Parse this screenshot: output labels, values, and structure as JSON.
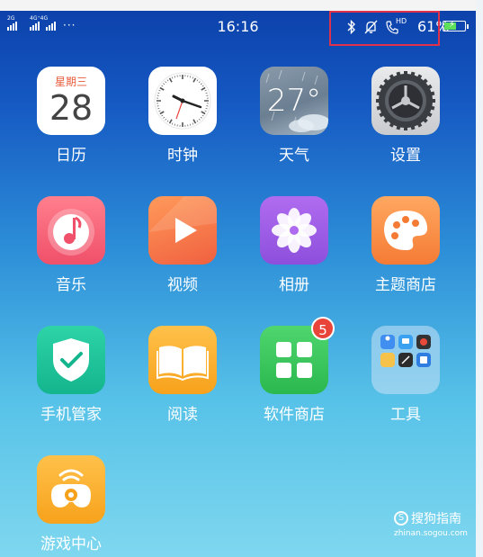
{
  "status_bar": {
    "network_tag_1": "2G",
    "network_tag_2": "4G⁺4G",
    "more": "···",
    "time": "16:16",
    "hd": "HD",
    "battery": "61%"
  },
  "apps": [
    {
      "id": "calendar",
      "label": "日历",
      "weekday": "星期三",
      "day": "28",
      "icon": "calendar-icon"
    },
    {
      "id": "clock",
      "label": "时钟",
      "icon": "clock-icon"
    },
    {
      "id": "weather",
      "label": "天气",
      "temp": "27°",
      "icon": "weather-icon"
    },
    {
      "id": "settings",
      "label": "设置",
      "icon": "gear-icon"
    },
    {
      "id": "music",
      "label": "音乐",
      "icon": "music-note-icon"
    },
    {
      "id": "video",
      "label": "视频",
      "icon": "play-icon"
    },
    {
      "id": "photos",
      "label": "相册",
      "icon": "flower-icon"
    },
    {
      "id": "theme",
      "label": "主题商店",
      "icon": "palette-icon"
    },
    {
      "id": "phone_manager",
      "label": "手机管家",
      "icon": "shield-check-icon"
    },
    {
      "id": "reader",
      "label": "阅读",
      "icon": "book-icon"
    },
    {
      "id": "app_store",
      "label": "软件商店",
      "badge": "5",
      "icon": "app-store-icon"
    },
    {
      "id": "tools",
      "label": "工具",
      "icon": "folder-icon"
    },
    {
      "id": "game_center",
      "label": "游戏中心",
      "icon": "gamepad-icon"
    }
  ],
  "watermark": {
    "brand": "搜狗指南",
    "site": "zhinan.sogou.com",
    "logo": "S"
  },
  "colors": {
    "annotation_box": "#e0314b",
    "badge": "#e8443a",
    "battery_fill": "#5fe05a"
  }
}
